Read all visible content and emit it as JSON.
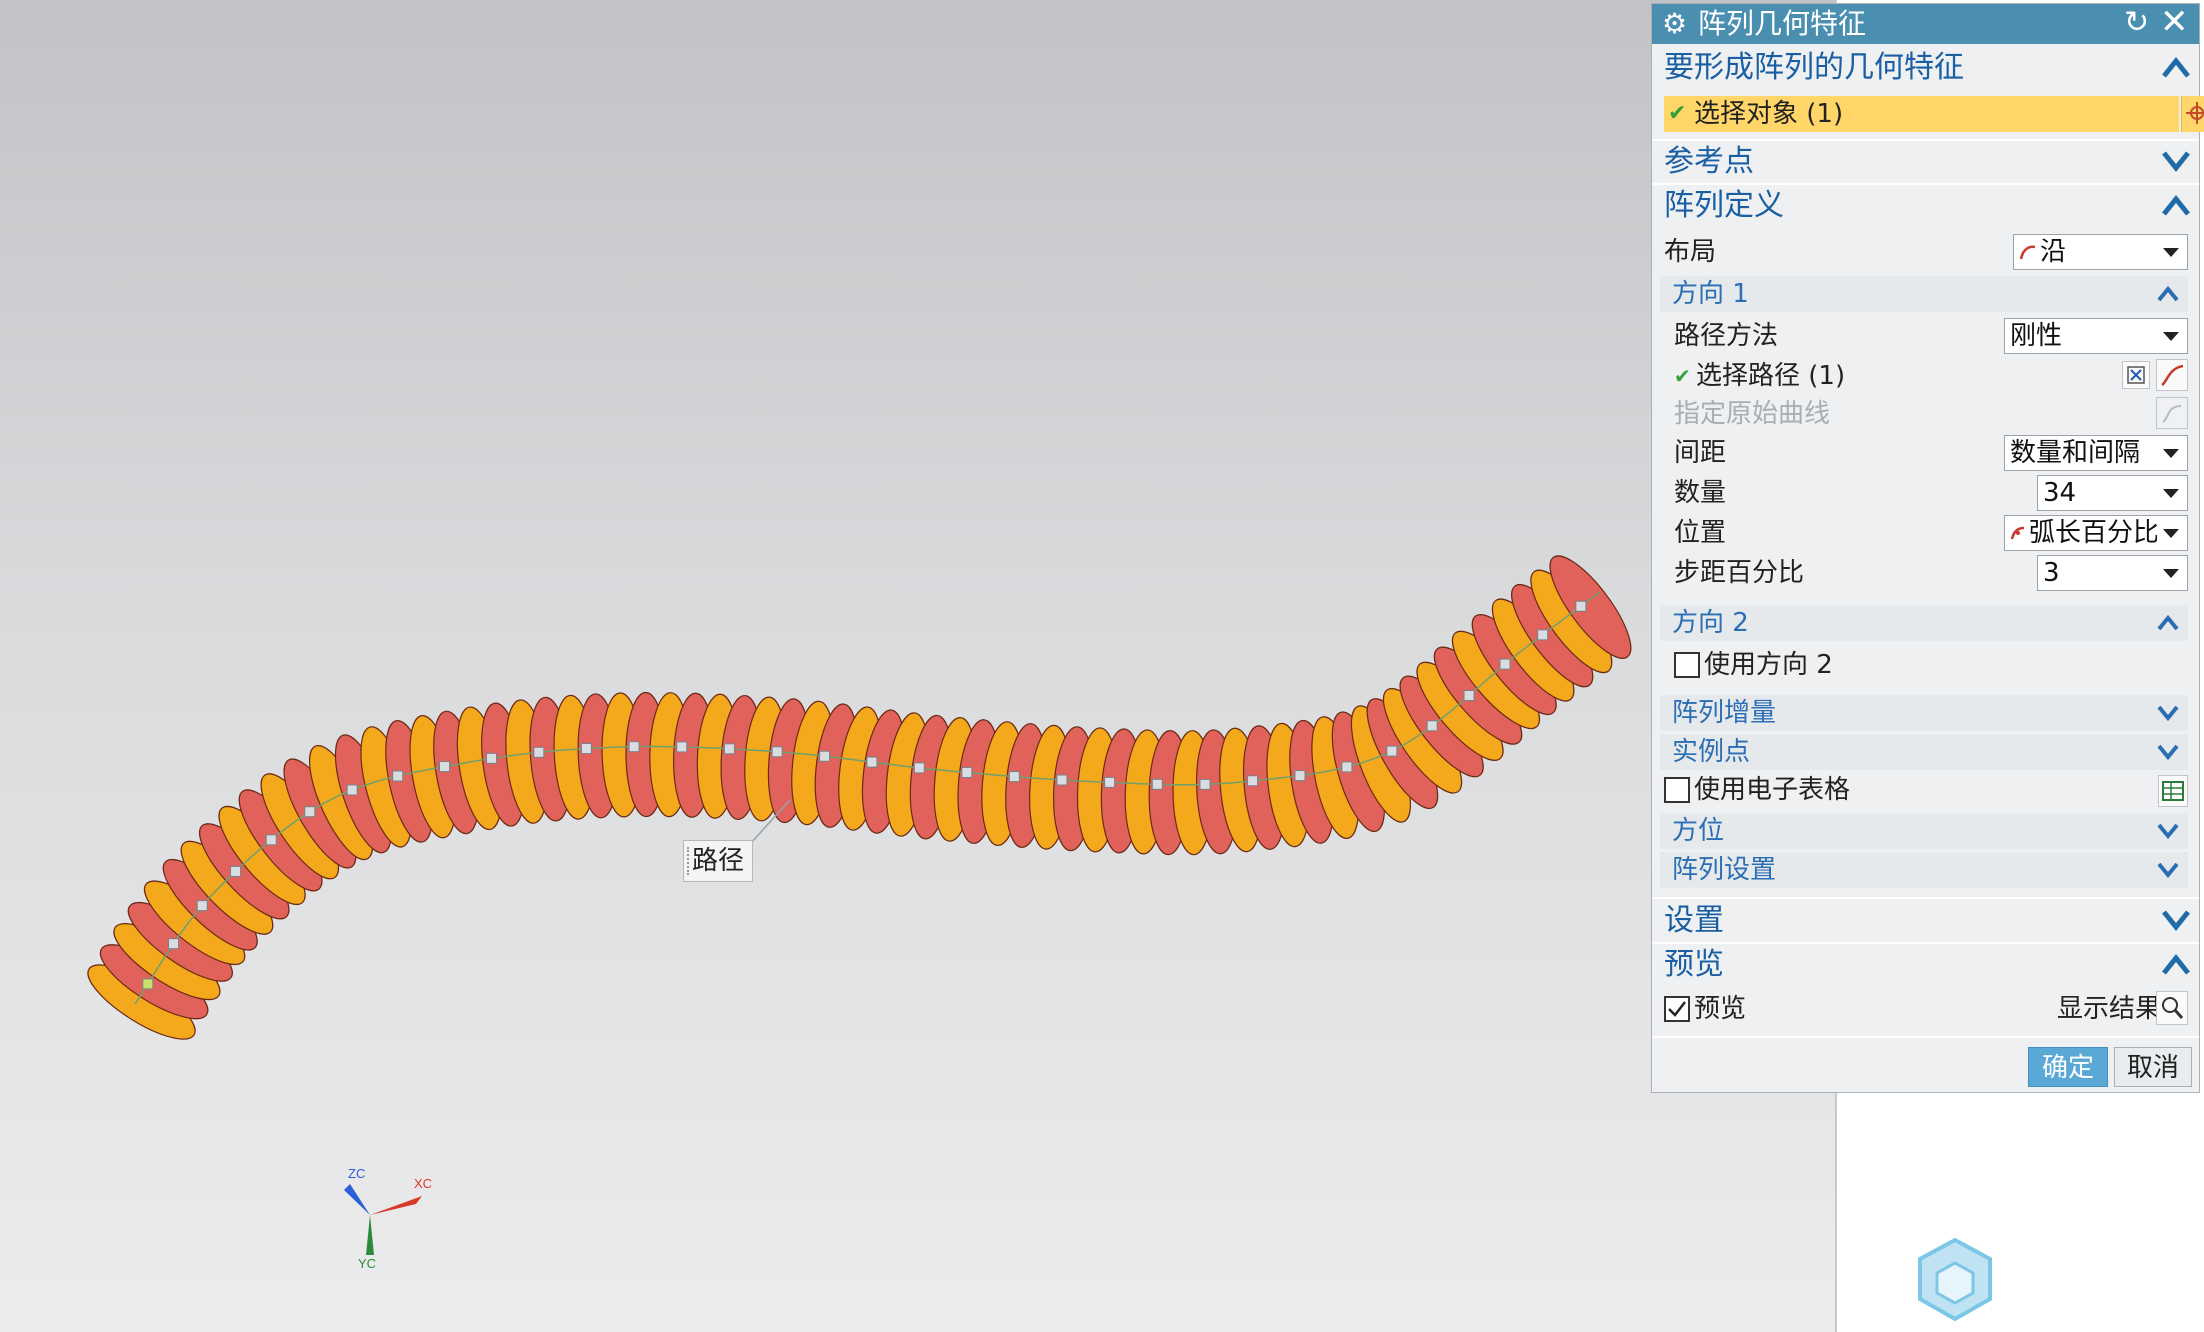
{
  "viewport": {
    "path_label": "路径",
    "axes": {
      "zc": "ZC",
      "xc": "XC",
      "yc": "YC"
    }
  },
  "dialog": {
    "title": "阵列几何特征",
    "icons": {
      "title": "gear-icon",
      "reset": "reset-icon",
      "close": "close-icon"
    },
    "geometry_section": {
      "label": "要形成阵列的几何特征",
      "select_object": "选择对象 (1)",
      "expanded": true
    },
    "reference_point": {
      "label": "参考点",
      "expanded": false
    },
    "pattern_definition": {
      "label": "阵列定义",
      "expanded": true,
      "layout_label": "布局",
      "layout_value": "沿",
      "direction1": {
        "label": "方向 1",
        "expanded": true,
        "path_method_label": "路径方法",
        "path_method_value": "刚性",
        "select_path": "选择路径 (1)",
        "specify_original_curve": "指定原始曲线",
        "spacing_label": "间距",
        "spacing_value": "数量和间隔",
        "count_label": "数量",
        "count_value": "34",
        "position_label": "位置",
        "position_value": "弧长百分比",
        "step_percent_label": "步距百分比",
        "step_percent_value": "3"
      },
      "direction2": {
        "label": "方向 2",
        "expanded": true,
        "use_direction2": "使用方向 2",
        "use_direction2_checked": false
      },
      "pattern_increment": {
        "label": "阵列增量",
        "expanded": false
      },
      "instance_point": {
        "label": "实例点",
        "expanded": false
      },
      "use_spreadsheet": "使用电子表格",
      "use_spreadsheet_checked": false,
      "orientation": {
        "label": "方位",
        "expanded": false
      },
      "pattern_settings": {
        "label": "阵列设置",
        "expanded": false
      }
    },
    "settings": {
      "label": "设置",
      "expanded": false
    },
    "preview": {
      "label": "预览",
      "expanded": true,
      "preview_checkbox": "预览",
      "preview_checked": true,
      "show_result": "显示结果"
    },
    "ok_label": "确定",
    "cancel_label": "取消"
  },
  "colors": {
    "ring_orange": "#f4a81c",
    "ring_red": "#e0625a",
    "title_bar": "#4a8fb0",
    "selection_highlight": "#ffd667",
    "section_text": "#1a5fa3",
    "ok_button": "#5aa8d6"
  }
}
